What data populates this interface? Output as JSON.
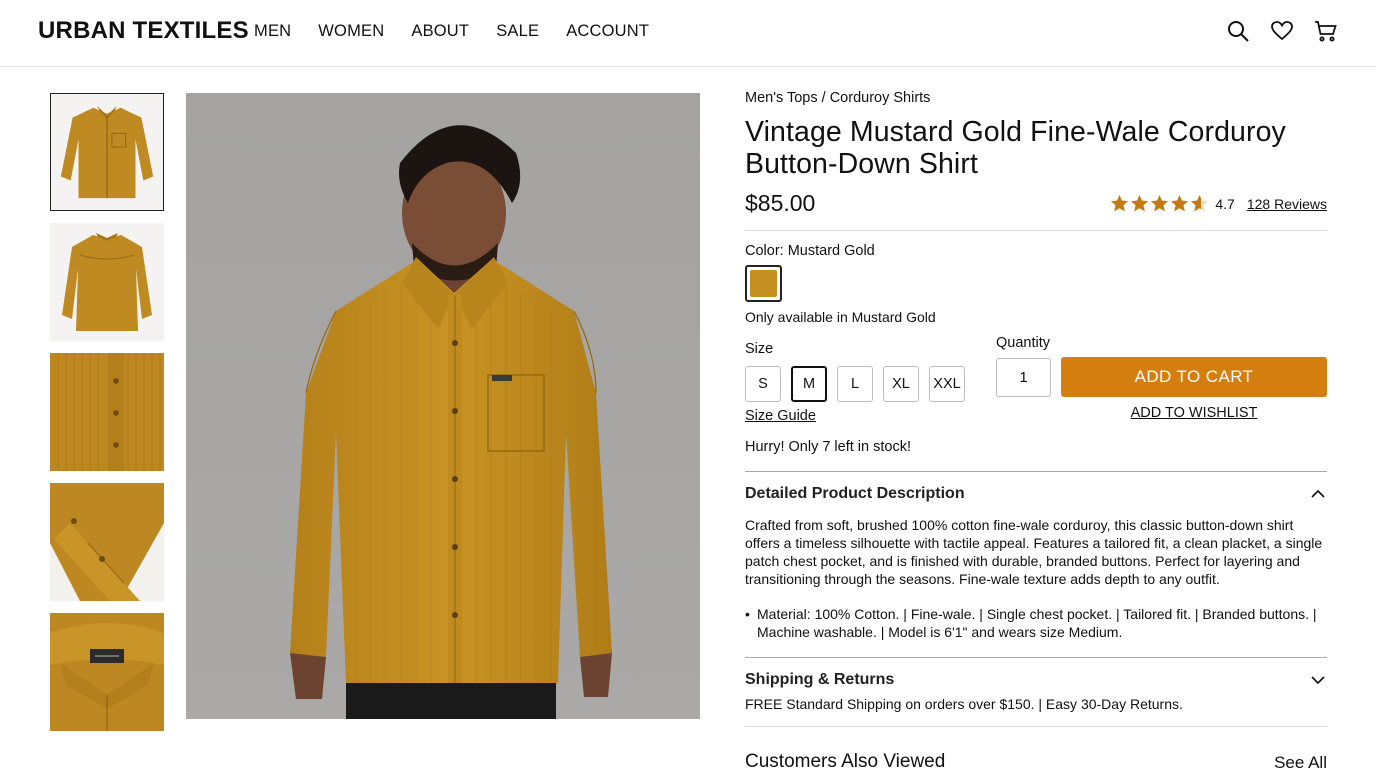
{
  "brand": {
    "logo": "URBAN TEXTILES"
  },
  "nav": {
    "items": [
      "MEN",
      "WOMEN",
      "ABOUT",
      "SALE",
      "ACCOUNT"
    ]
  },
  "header_icons": [
    "search-icon",
    "heart-icon",
    "cart-icon"
  ],
  "product": {
    "breadcrumb": "Men's Tops / Corduroy Shirts",
    "title": "Vintage Mustard Gold Fine-Wale Corduroy Button-Down Shirt",
    "price": "$85.00",
    "rating": {
      "value": "4.7",
      "stars": 4.7,
      "reviews": "128 Reviews"
    },
    "color_label": "Color: Mustard Gold",
    "swatch_color": "#c58f21",
    "only_available": "Only available in Mustard Gold",
    "size_label": "Size",
    "sizes": [
      "S",
      "M",
      "L",
      "XL",
      "XXL"
    ],
    "selected_size": "M",
    "size_guide": "Size Guide",
    "quantity_label": "Quantity",
    "quantity": "1",
    "add_to_cart": "ADD TO CART",
    "add_to_wishlist": "ADD TO WISHLIST",
    "stock_message": "Hurry! Only 7 left in stock!"
  },
  "accordion": {
    "description": {
      "title": "Detailed Product Description",
      "text": "Crafted from soft, brushed 100% cotton fine-wale corduroy, this classic button-down shirt offers a timeless silhouette with tactile appeal. Features a tailored fit, a clean placket, a single patch chest pocket, and is finished with durable, branded buttons. Perfect for layering and transitioning through the seasons. Fine-wale texture adds depth to any outfit.",
      "bullets": [
        "Material: 100% Cotton. | Fine-wale. | Single chest pocket. | Tailored fit. | Branded buttons. | Machine washable. | Model is 6'1\" and wears size Medium."
      ]
    },
    "shipping": {
      "title": "Shipping & Returns",
      "text": "FREE Standard Shipping on orders over $150. | Easy 30-Day Returns."
    }
  },
  "customers_also_viewed": {
    "title": "Customers Also Viewed",
    "see_all": "See All"
  },
  "colors": {
    "accent": "#d47e0f",
    "mustard": "#c58f21"
  }
}
